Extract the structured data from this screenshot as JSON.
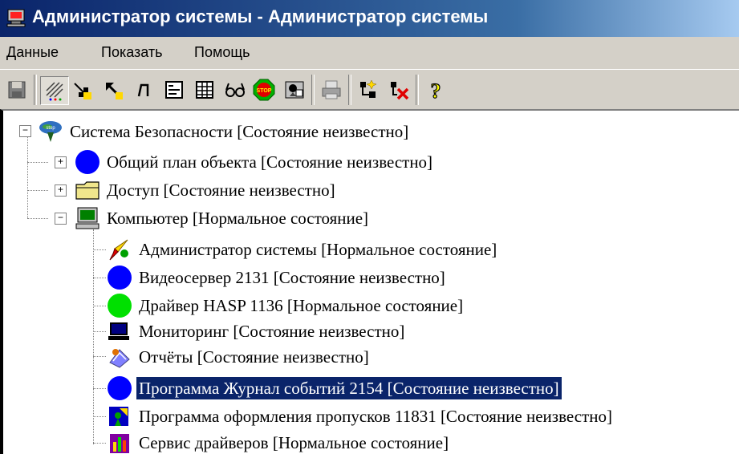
{
  "window": {
    "title": "Администратор системы - Администратор системы"
  },
  "menu": [
    "Данные",
    "Показать",
    "Помощь"
  ],
  "toolbar": {
    "buttons": [
      {
        "name": "save-icon"
      },
      {
        "name": "hatch-pattern-icon",
        "pressed": true
      },
      {
        "name": "arrow-down-right-icon"
      },
      {
        "name": "arrow-up-left-icon"
      },
      {
        "name": "lambda-icon"
      },
      {
        "name": "form-icon"
      },
      {
        "name": "table-icon"
      },
      {
        "name": "glasses-icon"
      },
      {
        "name": "stop-sign-icon",
        "text": "STOP"
      },
      {
        "name": "user-panel-icon"
      },
      {
        "name": "printer-icon"
      },
      {
        "name": "add-node-icon"
      },
      {
        "name": "delete-node-icon"
      },
      {
        "name": "help-icon",
        "text": "?"
      }
    ]
  },
  "tree": {
    "nodes": [
      {
        "label": "Система Безопасности [Состояние неизвестно]",
        "icon": "security-system-icon",
        "level": 0,
        "expander": "−"
      },
      {
        "label": "Общий план объекта [Состояние неизвестно]",
        "icon": "blue-circle-icon",
        "level": 1,
        "expander": "+"
      },
      {
        "label": "Доступ [Состояние неизвестно]",
        "icon": "folder-icon",
        "level": 1,
        "expander": "+"
      },
      {
        "label": "Компьютер [Нормальное состояние]",
        "icon": "computer-icon",
        "level": 1,
        "expander": "−"
      },
      {
        "label": "Администратор системы [Нормальное состояние]",
        "icon": "admin-tool-icon",
        "level": 2
      },
      {
        "label": "Видеосервер 2131 [Состояние неизвестно]",
        "icon": "blue-circle-icon",
        "level": 2
      },
      {
        "label": "Драйвер HASP 1136 [Нормальное состояние]",
        "icon": "green-circle-icon",
        "level": 2
      },
      {
        "label": "Мониторинг [Состояние неизвестно]",
        "icon": "monitor-icon",
        "level": 2
      },
      {
        "label": "Отчёты [Состояние неизвестно]",
        "icon": "reports-icon",
        "level": 2
      },
      {
        "label": "Программа Журнал событий 2154 [Состояние неизвестно]",
        "icon": "blue-circle-icon",
        "level": 2,
        "selected": true
      },
      {
        "label": "Программа оформления пропусков 11831 [Состояние неизвестно]",
        "icon": "pass-program-icon",
        "level": 2
      },
      {
        "label": "Сервис драйверов [Нормальное состояние]",
        "icon": "driver-service-icon",
        "level": 2
      }
    ]
  }
}
